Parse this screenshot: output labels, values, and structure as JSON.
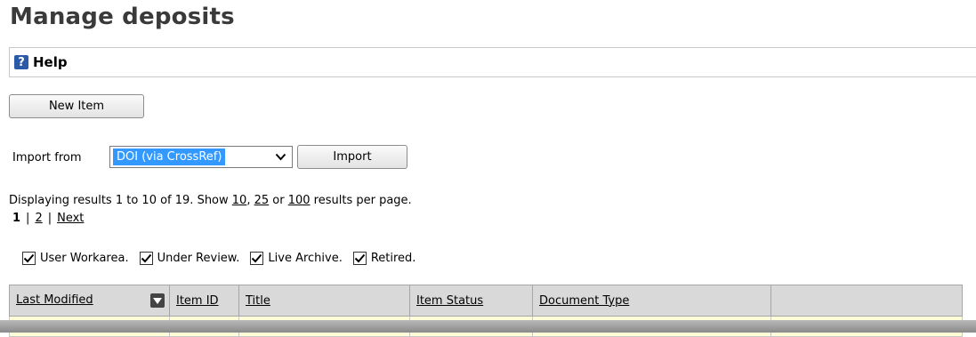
{
  "page": {
    "title": "Manage deposits"
  },
  "help": {
    "label": "Help",
    "icon": "?"
  },
  "actions": {
    "new_item_label": "New Item"
  },
  "import": {
    "label": "Import from",
    "selected_source": "DOI (via CrossRef)",
    "button_label": "Import"
  },
  "results": {
    "prefix": "Displaying results 1 to 10 of 19. Show ",
    "opt_10": "10",
    "comma": ", ",
    "opt_25": "25",
    "or": " or ",
    "opt_100": "100",
    "suffix": " results per page.",
    "current_page": "1",
    "sep": "|",
    "page_2": "2",
    "next_label": "Next"
  },
  "filters": [
    {
      "label": "User Workarea.",
      "checked": true
    },
    {
      "label": "Under Review.",
      "checked": true
    },
    {
      "label": "Live Archive.",
      "checked": true
    },
    {
      "label": "Retired.",
      "checked": true
    }
  ],
  "table": {
    "columns": [
      "Last Modified",
      "Item ID",
      "Title",
      "Item Status",
      "Document Type",
      ""
    ]
  },
  "colors": {
    "title": "#3a3a3a",
    "selection": "#3399ff",
    "row_highlight": "#fffdd6",
    "header_bg": "#d9d9d9"
  }
}
